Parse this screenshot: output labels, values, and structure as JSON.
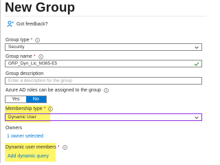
{
  "title": "New Group",
  "feedback": {
    "label": "Got feedback?"
  },
  "group_type": {
    "label": "Group type",
    "value": "Security"
  },
  "group_name": {
    "label": "Group name",
    "value": "GRP_Dyn_Lic_M365-E5"
  },
  "group_description": {
    "label": "Group description",
    "placeholder": "Enter a description for the group"
  },
  "azure_ad_roles": {
    "label": "Azure AD roles can be assigned to the group",
    "yes": "Yes",
    "no": "No",
    "selected": "No"
  },
  "membership_type": {
    "label": "Membership type",
    "value": "Dynamic User"
  },
  "owners": {
    "label": "Owners",
    "link": "1 owner selected"
  },
  "dynamic_members": {
    "label": "Dynamic user members",
    "link": "Add dynamic query"
  },
  "colors": {
    "accent": "#0078d4",
    "highlight": "#fff56a",
    "required": "#a4262c",
    "focus_border": "#8a2be2"
  }
}
